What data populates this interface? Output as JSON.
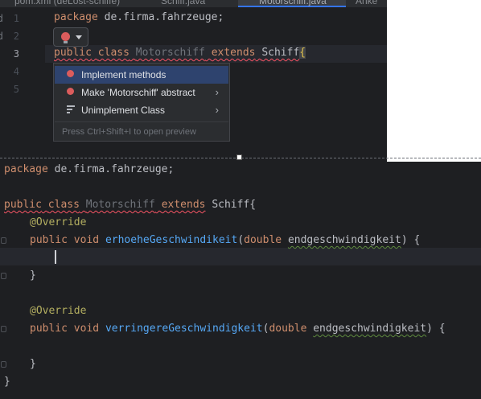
{
  "top_editor": {
    "tabs": [
      {
        "label": "pom.xml (deLost-schiffe)"
      },
      {
        "label": "Schiff.java"
      },
      {
        "label": "Motorschiff.java"
      },
      {
        "label": "Anke"
      }
    ],
    "line_numbers": [
      "1",
      "2",
      "3",
      "4",
      "5"
    ],
    "line1": {
      "kw": "package",
      "rest": " de.firma.fahrzeuge;"
    },
    "line3": {
      "kw_public": "public",
      "kw_class": "class",
      "cls_name": "Motorschiff",
      "kw_extends": "extends",
      "super_name": "Schiff",
      "brace": "{"
    },
    "gutter_labels": [
      "d",
      "d"
    ]
  },
  "intention_popup": {
    "items": [
      {
        "label": "Implement methods",
        "selected": true,
        "has_submenu": false,
        "icon": "error-bulb-icon"
      },
      {
        "label": "Make 'Motorschiff' abstract",
        "selected": false,
        "has_submenu": true,
        "icon": "error-bulb-icon"
      },
      {
        "label": "Unimplement Class",
        "selected": false,
        "has_submenu": true,
        "icon": "edit-lines-icon"
      }
    ],
    "hint": "Press Ctrl+Shift+I to open preview",
    "submenu_chevron": "›"
  },
  "bottom_editor": {
    "line_package": {
      "kw": "package",
      "rest": " de.firma.fahrzeuge;"
    },
    "line_class": {
      "kw_public": "public",
      "kw_class": "class",
      "cls_name": "Motorschiff",
      "kw_extends": "extends",
      "super_name": "Schiff",
      "brace": "{"
    },
    "override1": "@Override",
    "method1": {
      "kw_public": "public",
      "kw_void": "void",
      "name": "erhoeheGeschwindikeit",
      "paren_open": "(",
      "type": "double",
      "param": "endgeschwindigkeit",
      "tail": ") {"
    },
    "close1": "}",
    "override2": "@Override",
    "method2": {
      "kw_public": "public",
      "kw_void": "void",
      "name": "verringereGeschwindigkeit",
      "paren_open": "(",
      "type": "double",
      "param": "endgeschwindigkeit",
      "tail": ") {"
    },
    "close2": "}",
    "close_class": "}"
  },
  "colors": {
    "keyword": "#cf8e6d",
    "class_unused": "#6f737a",
    "annotation": "#b3ae60",
    "function": "#56a8f5",
    "text": "#bcbec4",
    "error_underline": "#f75464",
    "selection": "#2e436e"
  }
}
